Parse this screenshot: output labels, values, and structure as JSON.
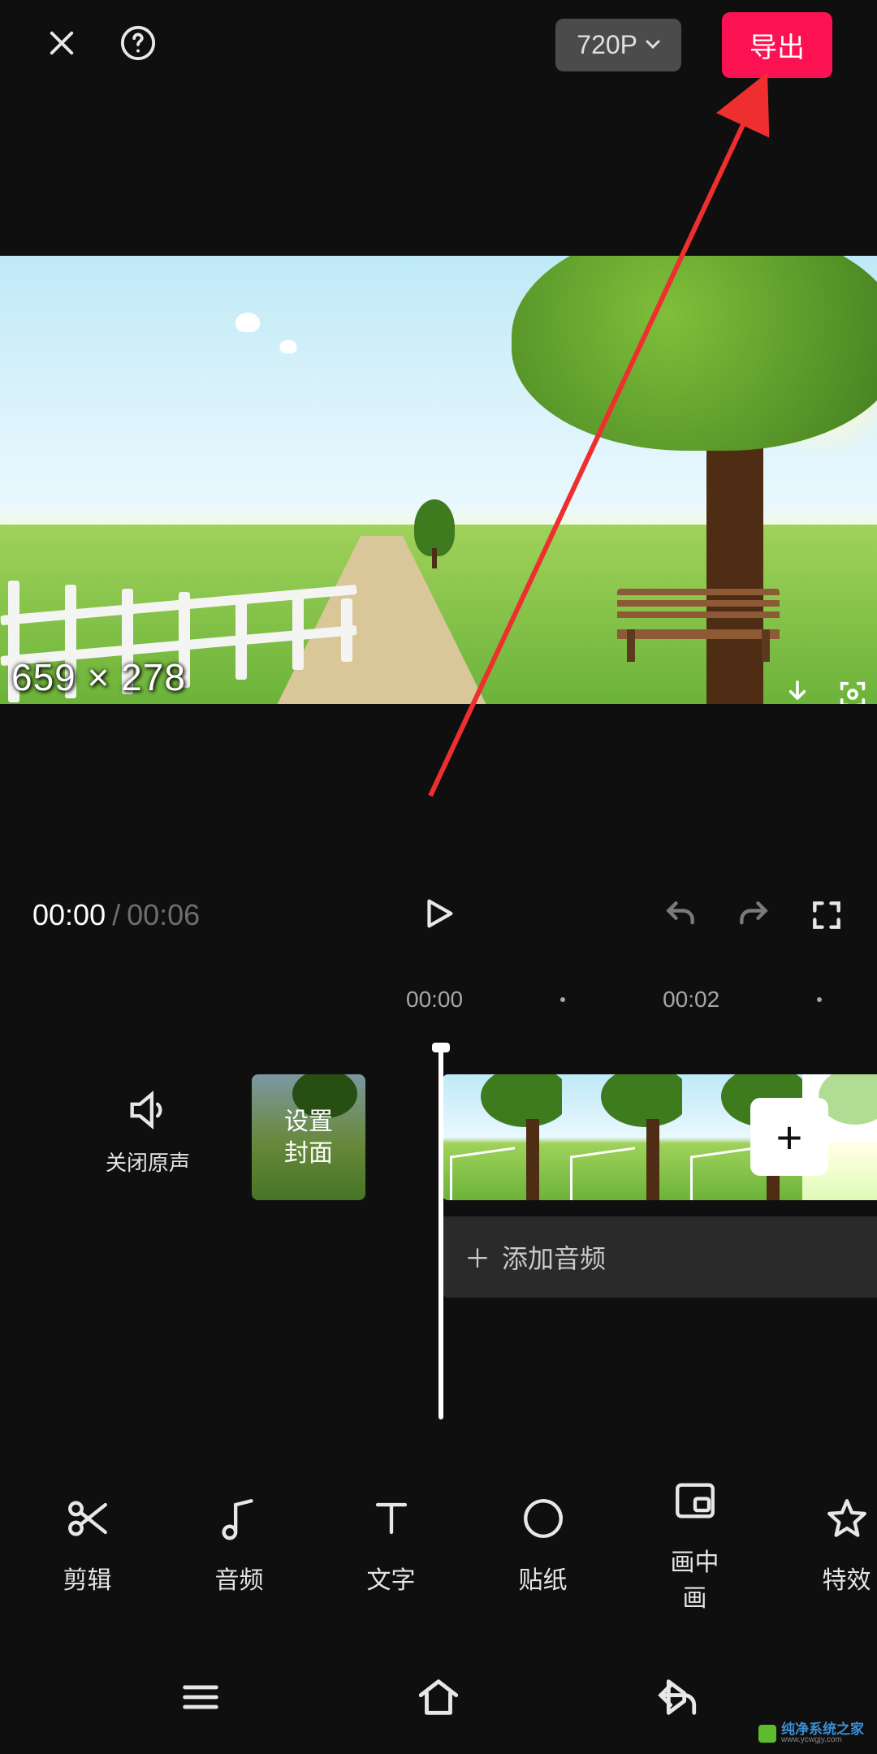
{
  "header": {
    "resolution": "720P",
    "export": "导出"
  },
  "preview": {
    "dimensions_label": "659 × 278"
  },
  "player": {
    "current": "00:00",
    "separator": "/",
    "duration": "00:06"
  },
  "ruler": {
    "t0": "00:00",
    "t1": "00:02"
  },
  "muteColumn": {
    "label": "关闭原声"
  },
  "cover": {
    "label": "设置\n封面"
  },
  "addAudio": {
    "symbol": "＋",
    "label": "添加音频"
  },
  "addClip": {
    "symbol": "+"
  },
  "tools": [
    {
      "id": "edit",
      "label": "剪辑"
    },
    {
      "id": "audio",
      "label": "音频"
    },
    {
      "id": "text",
      "label": "文字"
    },
    {
      "id": "sticker",
      "label": "贴纸"
    },
    {
      "id": "pip",
      "label": "画中画"
    },
    {
      "id": "fx",
      "label": "特效"
    }
  ],
  "watermark": {
    "line1": "纯净系统之家",
    "line2": "www.ycwgjy.com"
  },
  "colors": {
    "accent": "#fc1152"
  }
}
